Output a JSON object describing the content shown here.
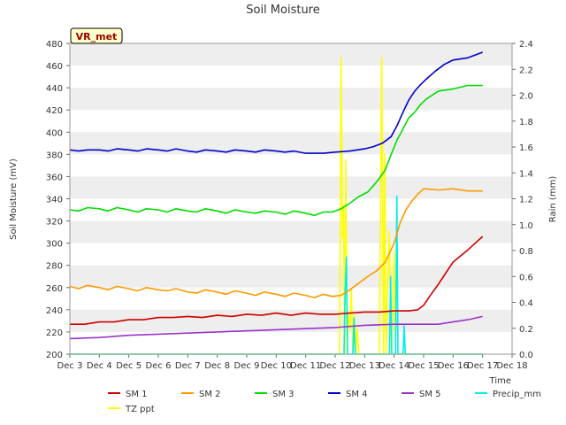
{
  "chart_data": {
    "type": "line",
    "title": "Soil Moisture",
    "xlabel": "Time",
    "ylabel_left": "Soil Moisture (mV)",
    "ylabel_right": "Rain (mm)",
    "site_label": "VR_met",
    "xlim": [
      3,
      18
    ],
    "ylim_left": [
      200,
      480
    ],
    "ylim_right": [
      0,
      2.4
    ],
    "x_tick_values": [
      3,
      4,
      5,
      6,
      7,
      8,
      9,
      10,
      11,
      12,
      13,
      14,
      15,
      16,
      17,
      18
    ],
    "x_tick_labels": [
      "Dec 3",
      "Dec 4",
      "Dec 5",
      "Dec 6",
      "Dec 7",
      "Dec 8",
      "Dec 9",
      "Dec 10",
      "Dec 11",
      "Dec 12",
      "Dec 13",
      "Dec 14",
      "Dec 15",
      "Dec 16",
      "Dec 17",
      "Dec 18"
    ],
    "y_left_ticks": [
      200,
      220,
      240,
      260,
      280,
      300,
      320,
      340,
      360,
      380,
      400,
      420,
      440,
      460,
      480
    ],
    "y_right_ticks": [
      "0.0",
      "0.2",
      "0.4",
      "0.6",
      "0.8",
      "1.0",
      "1.2",
      "1.4",
      "1.6",
      "1.8",
      "2.0",
      "2.2",
      "2.4"
    ],
    "grid": "horizontal bands",
    "legend_position": "bottom",
    "series": [
      {
        "name": "SM 1",
        "color": "#cc0000",
        "axis": "left",
        "x": [
          3,
          3.5,
          4,
          4.5,
          5,
          5.5,
          6,
          6.5,
          7,
          7.5,
          8,
          8.5,
          9,
          9.5,
          10,
          10.5,
          11,
          11.5,
          12,
          12.5,
          13,
          13.5,
          14,
          14.5,
          14.8,
          15,
          15.2,
          15.5,
          16,
          16.5,
          17
        ],
        "y": [
          227,
          227,
          229,
          229,
          231,
          231,
          233,
          233,
          234,
          233,
          235,
          234,
          236,
          235,
          237,
          235,
          237,
          236,
          236,
          237,
          238,
          238,
          239,
          239,
          240,
          244,
          252,
          263,
          283,
          294,
          306
        ]
      },
      {
        "name": "SM 2",
        "color": "#ff9900",
        "axis": "left",
        "x": [
          3,
          3.3,
          3.6,
          4,
          4.3,
          4.6,
          5,
          5.3,
          5.6,
          6,
          6.3,
          6.6,
          7,
          7.3,
          7.6,
          8,
          8.3,
          8.6,
          9,
          9.3,
          9.6,
          10,
          10.3,
          10.6,
          11,
          11.3,
          11.6,
          11.9,
          12.2,
          12.5,
          12.8,
          13.1,
          13.4,
          13.7,
          14,
          14.2,
          14.4,
          14.6,
          14.8,
          15,
          15.5,
          16,
          16.5,
          17
        ],
        "y": [
          261,
          259,
          262,
          260,
          258,
          261,
          259,
          257,
          260,
          258,
          257,
          259,
          256,
          255,
          258,
          256,
          254,
          257,
          255,
          253,
          256,
          254,
          252,
          255,
          253,
          251,
          254,
          252,
          253,
          258,
          264,
          270,
          275,
          283,
          300,
          318,
          330,
          338,
          344,
          349,
          348,
          349,
          347,
          347
        ]
      },
      {
        "name": "SM 3",
        "color": "#00dd00",
        "axis": "left",
        "x": [
          3,
          3.3,
          3.6,
          4,
          4.3,
          4.6,
          5,
          5.3,
          5.6,
          6,
          6.3,
          6.6,
          7,
          7.3,
          7.6,
          8,
          8.3,
          8.6,
          9,
          9.3,
          9.6,
          10,
          10.3,
          10.6,
          11,
          11.3,
          11.6,
          11.9,
          12.2,
          12.5,
          12.8,
          13.1,
          13.4,
          13.7,
          13.9,
          14.1,
          14.3,
          14.5,
          14.7,
          14.9,
          15.1,
          15.5,
          16,
          16.5,
          17
        ],
        "y": [
          330,
          329,
          332,
          331,
          329,
          332,
          330,
          328,
          331,
          330,
          328,
          331,
          329,
          328,
          331,
          329,
          327,
          330,
          328,
          327,
          329,
          328,
          326,
          329,
          327,
          325,
          328,
          328,
          331,
          336,
          342,
          346,
          355,
          366,
          380,
          393,
          403,
          413,
          418,
          425,
          430,
          437,
          439,
          442,
          442
        ]
      },
      {
        "name": "SM 4",
        "color": "#0000cc",
        "axis": "left",
        "x": [
          3,
          3.3,
          3.6,
          4,
          4.3,
          4.6,
          5,
          5.3,
          5.6,
          6,
          6.3,
          6.6,
          7,
          7.3,
          7.6,
          8,
          8.3,
          8.6,
          9,
          9.3,
          9.6,
          10,
          10.3,
          10.6,
          11,
          11.3,
          11.6,
          12,
          12.5,
          13,
          13.3,
          13.6,
          13.9,
          14.1,
          14.3,
          14.5,
          14.7,
          14.9,
          15.1,
          15.4,
          15.7,
          16,
          16.5,
          17
        ],
        "y": [
          384,
          383,
          384,
          384,
          383,
          385,
          384,
          383,
          385,
          384,
          383,
          385,
          383,
          382,
          384,
          383,
          382,
          384,
          383,
          382,
          384,
          383,
          382,
          383,
          381,
          381,
          381,
          382,
          383,
          385,
          387,
          390,
          396,
          406,
          418,
          429,
          437,
          443,
          448,
          455,
          461,
          465,
          467,
          472
        ]
      },
      {
        "name": "SM 5",
        "color": "#9933cc",
        "axis": "left",
        "x": [
          3,
          4,
          5,
          6,
          7,
          8,
          9,
          10,
          11,
          12,
          13,
          14,
          15,
          15.5,
          16,
          16.5,
          17
        ],
        "y": [
          214,
          215,
          217,
          218,
          219,
          220,
          221,
          222,
          223,
          224,
          226,
          227,
          227,
          227,
          229,
          231,
          234
        ]
      },
      {
        "name": "Precip_mm",
        "color": "#00eeee",
        "axis": "right",
        "x": [
          3,
          12.3,
          12.34,
          12.38,
          12.42,
          12.46,
          12.6,
          12.64,
          12.68,
          13.8,
          13.84,
          13.88,
          13.92,
          14.05,
          14.09,
          14.13,
          14.3,
          14.34,
          14.38,
          17
        ],
        "y": [
          0,
          0,
          0.5,
          0.75,
          0,
          0,
          0,
          0.28,
          0,
          0,
          0,
          0.6,
          0,
          0,
          1.22,
          0,
          0,
          0.22,
          0,
          0
        ]
      },
      {
        "name": "TZ ppt",
        "color": "#ffff00",
        "axis": "right",
        "x": [
          3,
          12.15,
          12.2,
          12.25,
          12.28,
          12.32,
          12.36,
          12.4,
          12.45,
          12.5,
          12.55,
          12.6,
          12.65,
          12.7,
          12.75,
          12.8,
          13.5,
          13.58,
          13.64,
          13.68,
          13.72,
          13.78,
          13.84,
          13.9,
          13.95,
          14.0,
          14.05,
          14.1,
          17
        ],
        "y": [
          0,
          0,
          2.29,
          0.9,
          1.15,
          0,
          1.5,
          0,
          0.3,
          0.2,
          0.5,
          0,
          0.3,
          0,
          0.2,
          0,
          0,
          2.29,
          0,
          1.55,
          0,
          0.5,
          0.95,
          0,
          0.3,
          0.8,
          0,
          0,
          0
        ]
      }
    ]
  }
}
